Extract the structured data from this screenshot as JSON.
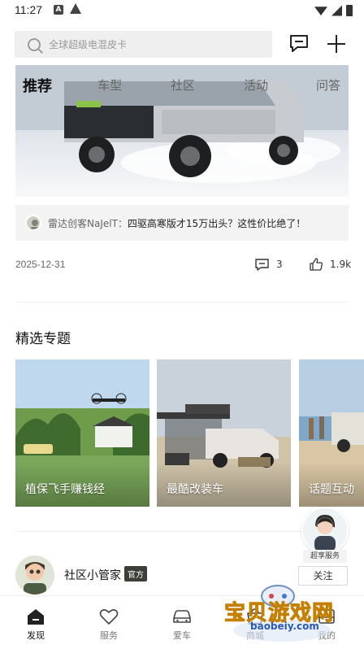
{
  "status_bar": {
    "time": "11:27"
  },
  "search": {
    "placeholder": "全球超级电混皮卡"
  },
  "tabs": [
    {
      "label": "推荐",
      "active": true
    },
    {
      "label": "车型",
      "active": false
    },
    {
      "label": "社区",
      "active": false
    },
    {
      "label": "活动",
      "active": false
    },
    {
      "label": "问答",
      "active": false
    }
  ],
  "post": {
    "author": "雷达创客NaJelT：",
    "text": "四驱高寒版才15万出头？这性价比绝了！",
    "date": "2025-12-31",
    "comments": "3",
    "likes": "1.9k"
  },
  "featured": {
    "title": "精选专题",
    "topics": [
      {
        "label": "植保飞手赚钱经"
      },
      {
        "label": "最酷改装车"
      },
      {
        "label": "话题互动"
      }
    ]
  },
  "manager": {
    "name": "社区小管家",
    "badge": "官方",
    "follow_label": "关注"
  },
  "service": {
    "label": "超享服务"
  },
  "nav": [
    {
      "label": "发现",
      "icon": "home-icon",
      "active": true
    },
    {
      "label": "服务",
      "icon": "heart-icon",
      "active": false
    },
    {
      "label": "爱车",
      "icon": "car-icon",
      "active": false
    },
    {
      "label": "商城",
      "icon": "shop-icon",
      "active": false
    },
    {
      "label": "我的",
      "icon": "profile-icon",
      "active": false
    }
  ],
  "watermark": {
    "text": "宝贝游戏网",
    "url": "baobeiy.com"
  },
  "colors": {
    "accent": "#111111",
    "badge": "#3b3f36",
    "muted": "#999999"
  }
}
